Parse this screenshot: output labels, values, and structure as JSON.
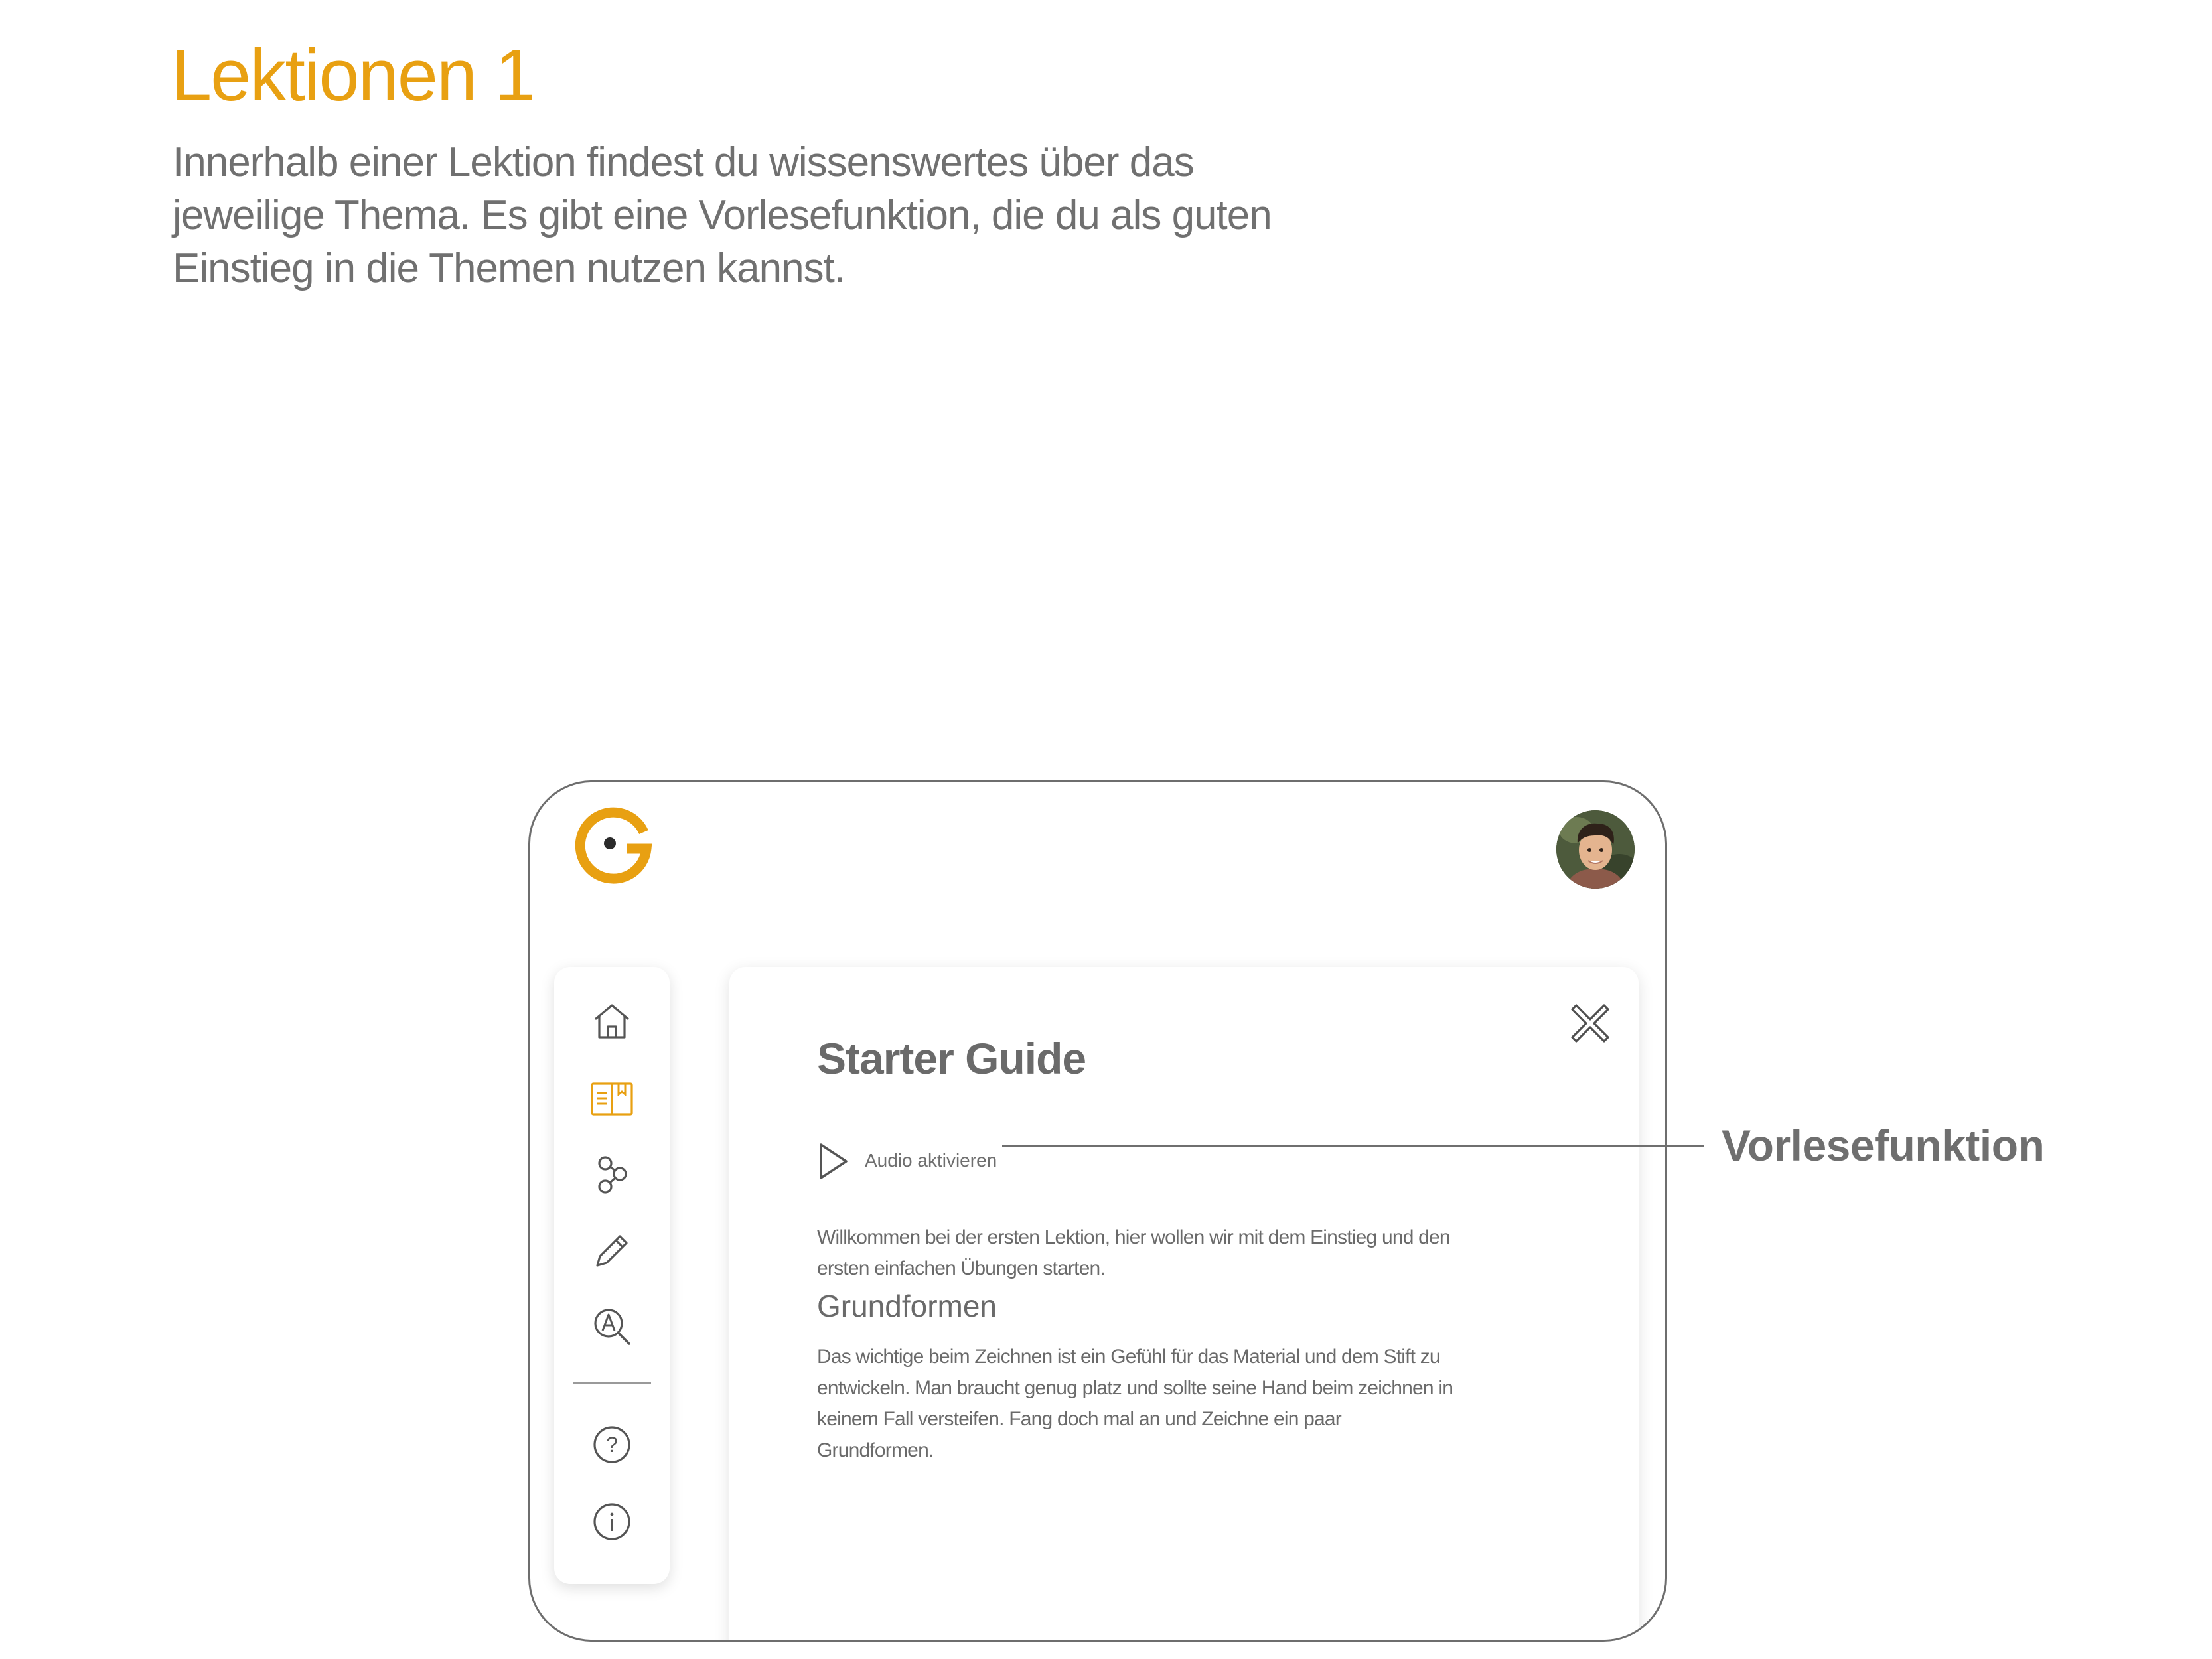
{
  "page": {
    "heading": "Lektionen 1",
    "intro": "Innerhalb einer Lektion findest du wissenswertes über das jeweilige Thema. Es gibt eine Vorlesefunktion, die du als guten Einstieg in die Themen nutzen kannst.",
    "callout_label": "Vorlesefunktion"
  },
  "colors": {
    "accent": "#e8a012",
    "text": "#6a6a6a",
    "frame": "#6e6e6e"
  },
  "app": {
    "logo_icon": "brand-logo-g",
    "avatar_icon": "user-avatar-photo",
    "sidebar": {
      "items": [
        {
          "icon": "home-icon",
          "active": false
        },
        {
          "icon": "lessons-book-icon",
          "active": true
        },
        {
          "icon": "exercises-circles-icon",
          "active": false
        },
        {
          "icon": "pencil-icon",
          "active": false
        },
        {
          "icon": "search-glossary-icon",
          "active": false
        }
      ],
      "bottom_items": [
        {
          "icon": "help-question-icon"
        },
        {
          "icon": "info-icon"
        }
      ]
    },
    "lesson": {
      "title": "Starter Guide",
      "audio_label": "Audio aktivieren",
      "intro_text": "Willkommen bei der ersten Lektion, hier wollen wir mit dem Einstieg und den ersten einfachen Übungen starten.",
      "section_title": "Grundformen",
      "section_text": "Das wichtige beim Zeichnen ist ein Gefühl für das Material und dem Stift zu entwickeln. Man braucht genug platz und sollte seine Hand beim zeichnen in keinem Fall versteifen. Fang doch mal an und Zeichne ein paar Grundformen."
    }
  }
}
